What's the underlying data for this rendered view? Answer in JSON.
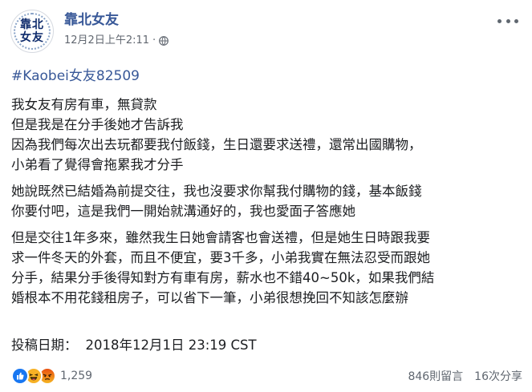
{
  "header": {
    "avatar_line1": "靠北",
    "avatar_line2": "女友",
    "page_name": "靠北女友",
    "timestamp": "12月2日上午2:11",
    "separator": "·",
    "privacy_icon": "globe-icon",
    "more_icon": "more-horizontal-icon"
  },
  "post": {
    "hashtag": "#Kaobei女友82509",
    "paragraphs": [
      {
        "lines": [
          "我女友有房有車，無貸款",
          "但是我是在分手後她才告訴我",
          "因為我們每次出去玩都要我付飯錢，生日還要求送禮，還常出國購物，",
          "小弟看了覺得會拖累我才分手"
        ]
      },
      {
        "lines": [
          "她說既然已結婚為前提交往，我也沒要求你幫我付購物的錢，基本飯錢",
          "你要付吧，這是我們一開始就溝通好的，我也愛面子答應她"
        ]
      },
      {
        "lines": [
          "但是交往1年多來，雖然我生日她會請客也會送禮，但是她生日時跟我要",
          "求一件冬天的外套，而且不便宜，要3千多，小弟我實在無法忍受而跟她",
          "分手，結果分手後得知對方有車有房，薪水也不錯40~50k，如果我們結",
          "婚根本不用花錢租房子，可以省下一筆，小弟很想挽回不知該怎麼辦"
        ]
      }
    ],
    "submit_label": "投稿日期：",
    "submit_date": "2018年12月1日 23:19 CST"
  },
  "footer": {
    "reactions": [
      "like-icon",
      "haha-icon",
      "angry-icon"
    ],
    "reaction_count": "1,259",
    "comments": "846則留言",
    "shares": "16次分享"
  },
  "colors": {
    "link": "#385898",
    "meta": "#616770",
    "text": "#1c1e21",
    "like": "#1877f2",
    "haha": "#f7b125",
    "angry": "#e9710f"
  }
}
